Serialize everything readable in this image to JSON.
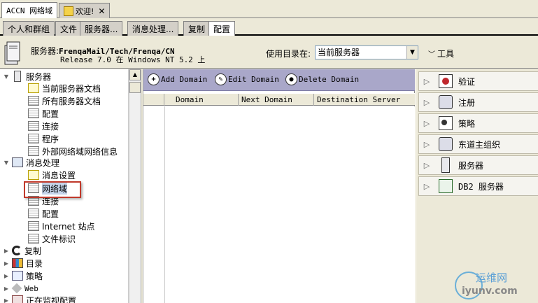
{
  "window_tabs": [
    {
      "label": "ACCN 网络域",
      "active": true
    },
    {
      "label": "欢迎!",
      "active": false
    }
  ],
  "sub_tabs": [
    {
      "label": "个人和群组"
    },
    {
      "label": "文件"
    },
    {
      "label": "服务器..."
    },
    {
      "label": "消息处理..."
    },
    {
      "label": "复制"
    },
    {
      "label": "配置",
      "active": true
    }
  ],
  "header": {
    "server_prefix": "服务器:",
    "server_name": "FrenqaMail/Tech/Frenqa/CN",
    "release": "Release 7.0 在 Windows NT 5.2 上",
    "directory_label": "使用目录在:",
    "directory_value": "当前服务器",
    "tools_label": "工具"
  },
  "tree": [
    {
      "label": "服务器",
      "icon": "server-icon",
      "expanded": true,
      "level": 0
    },
    {
      "label": "当前服务器文档",
      "icon": "document-icon",
      "level": 1
    },
    {
      "label": "所有服务器文档",
      "icon": "table-icon",
      "level": 1
    },
    {
      "label": "配置",
      "icon": "table-icon",
      "level": 1
    },
    {
      "label": "连接",
      "icon": "table-icon",
      "level": 1
    },
    {
      "label": "程序",
      "icon": "table-icon",
      "level": 1
    },
    {
      "label": "外部网络域网络信息",
      "icon": "table-icon",
      "level": 1
    },
    {
      "label": "消息处理",
      "icon": "messaging-icon",
      "expanded": true,
      "level": 0
    },
    {
      "label": "消息设置",
      "icon": "document-icon",
      "level": 1
    },
    {
      "label": "网络域",
      "icon": "table-icon",
      "level": 1,
      "selected": true
    },
    {
      "label": "连接",
      "icon": "table-icon",
      "level": 1
    },
    {
      "label": "配置",
      "icon": "table-icon",
      "level": 1
    },
    {
      "label": "Internet 站点",
      "icon": "table-icon",
      "level": 1
    },
    {
      "label": "文件标识",
      "icon": "table-icon",
      "level": 1
    },
    {
      "label": "复制",
      "icon": "sync-icon",
      "expanded": false,
      "level": 0
    },
    {
      "label": "目录",
      "icon": "directory-icon",
      "expanded": false,
      "level": 0
    },
    {
      "label": "策略",
      "icon": "policy-icon",
      "expanded": false,
      "level": 0
    },
    {
      "label": "Web",
      "icon": "web-icon",
      "expanded": false,
      "level": 0
    },
    {
      "label": "正在监视配置",
      "icon": "monitor-icon",
      "expanded": false,
      "level": 0
    }
  ],
  "actions": {
    "add": "Add Domain",
    "edit": "Edit Domain",
    "delete": "Delete Domain"
  },
  "columns": [
    "Domain",
    "Next Domain",
    "Destination Server"
  ],
  "right_panel": [
    {
      "label": "验证",
      "icon": "verify-icon"
    },
    {
      "label": "注册",
      "icon": "register-icon"
    },
    {
      "label": "策略",
      "icon": "policy-icon"
    },
    {
      "label": "东道主组织",
      "icon": "hosted-org-icon"
    },
    {
      "label": "服务器",
      "icon": "server-icon"
    },
    {
      "label": "DB2 服务器",
      "icon": "db2-server-icon"
    }
  ],
  "watermark": {
    "top": "运维网",
    "bottom": "iyunv.com"
  }
}
